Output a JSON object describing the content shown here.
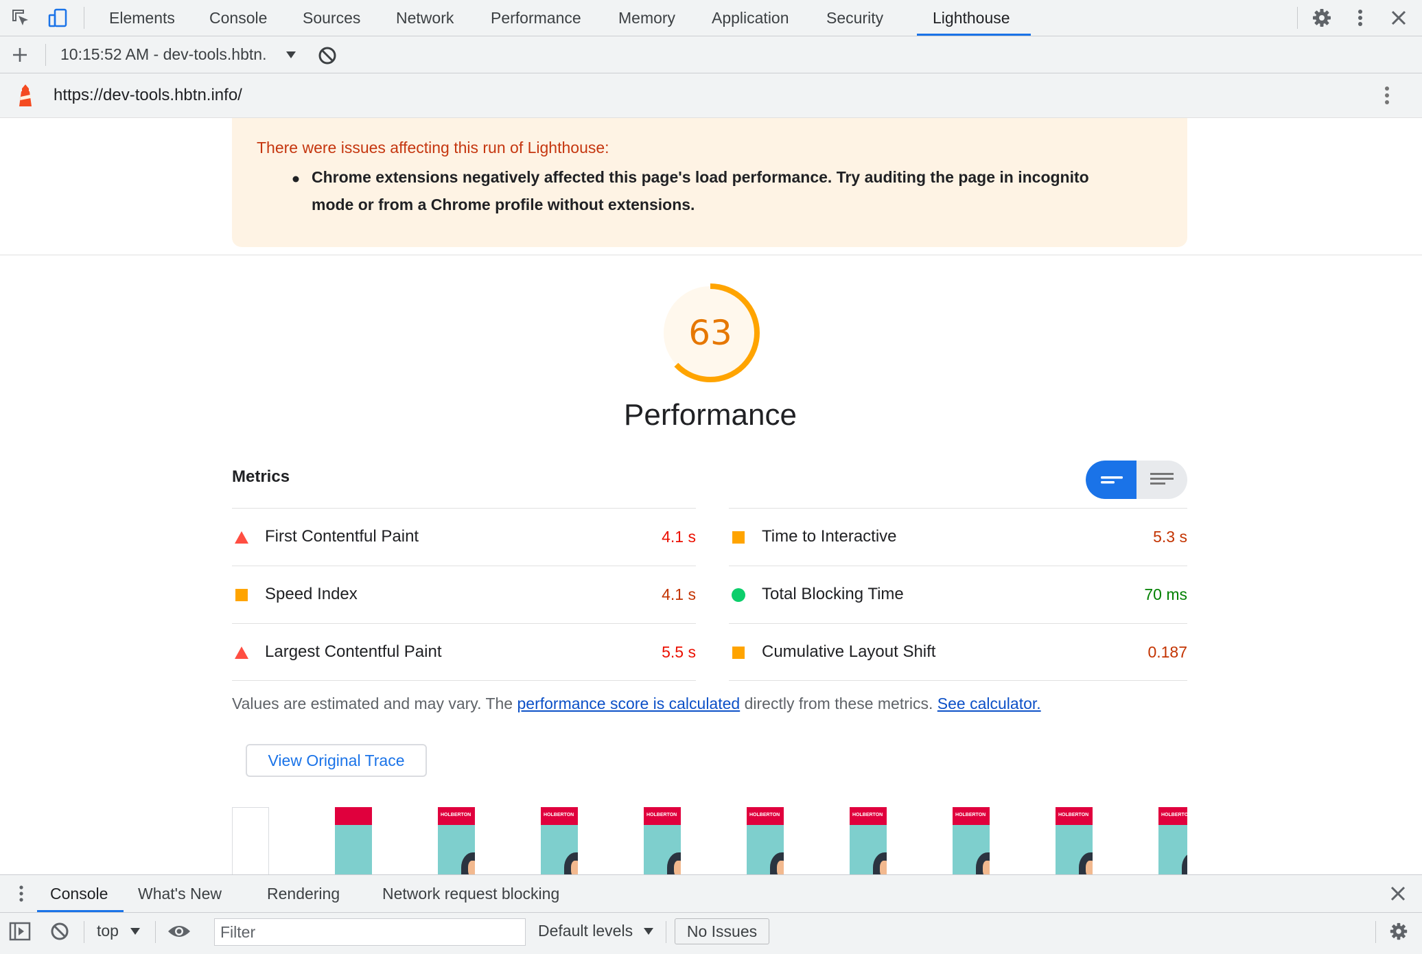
{
  "devtools": {
    "tabs": [
      "Elements",
      "Console",
      "Sources",
      "Network",
      "Performance",
      "Memory",
      "Application",
      "Security",
      "Lighthouse"
    ],
    "active_tab": "Lighthouse",
    "icons": [
      "inspect-element-icon",
      "device-toolbar-icon",
      "settings-gear-icon",
      "more-vert-icon",
      "close-icon"
    ]
  },
  "lighthouse_toolbar": {
    "report_selector": "10:15:52 AM - dev-tools.hbtn.",
    "icons": [
      "add-icon",
      "dropdown-caret-icon",
      "clear-block-icon"
    ]
  },
  "url_bar": {
    "url": "https://dev-tools.hbtn.info/",
    "icons": [
      "lighthouse-logo-icon",
      "more-vert-icon"
    ]
  },
  "warning": {
    "title": "There were issues affecting this run of Lighthouse:",
    "bullet": "Chrome extensions negatively affected this page's load performance. Try auditing the page in incognito mode or from a Chrome profile without extensions."
  },
  "gauge": {
    "score": "63",
    "score_value": 0.63,
    "label": "Performance",
    "color": "#ffa400"
  },
  "metrics": {
    "title": "Metrics",
    "left": [
      {
        "name": "First Contentful Paint",
        "value": "4.1 s",
        "status": "fail"
      },
      {
        "name": "Speed Index",
        "value": "4.1 s",
        "status": "average"
      },
      {
        "name": "Largest Contentful Paint",
        "value": "5.5 s",
        "status": "fail"
      }
    ],
    "right": [
      {
        "name": "Time to Interactive",
        "value": "5.3 s",
        "status": "average"
      },
      {
        "name": "Total Blocking Time",
        "value": "70 ms",
        "status": "pass"
      },
      {
        "name": "Cumulative Layout Shift",
        "value": "0.187",
        "status": "average"
      }
    ],
    "status_colors": {
      "fail": "#eb0f00",
      "average": "#c33300",
      "pass": "#008000"
    },
    "icon_colors": {
      "fail": "#ff4e42",
      "average": "#ffa400",
      "pass": "#0cce6b"
    }
  },
  "note": {
    "prefix": "Values are estimated and may vary. The ",
    "link1": "performance score is calculated",
    "middle": " directly from these metrics. ",
    "link2": "See calculator."
  },
  "trace_button": "View Original Trace",
  "filmstrip": {
    "frames": 10,
    "banner_text": "HOLBERTON"
  },
  "drawer": {
    "tabs": [
      "Console",
      "What's New",
      "Rendering",
      "Network request blocking"
    ],
    "active_tab": "Console",
    "context": "top",
    "filter_placeholder": "Filter",
    "levels": "Default levels",
    "issues": "No Issues"
  }
}
